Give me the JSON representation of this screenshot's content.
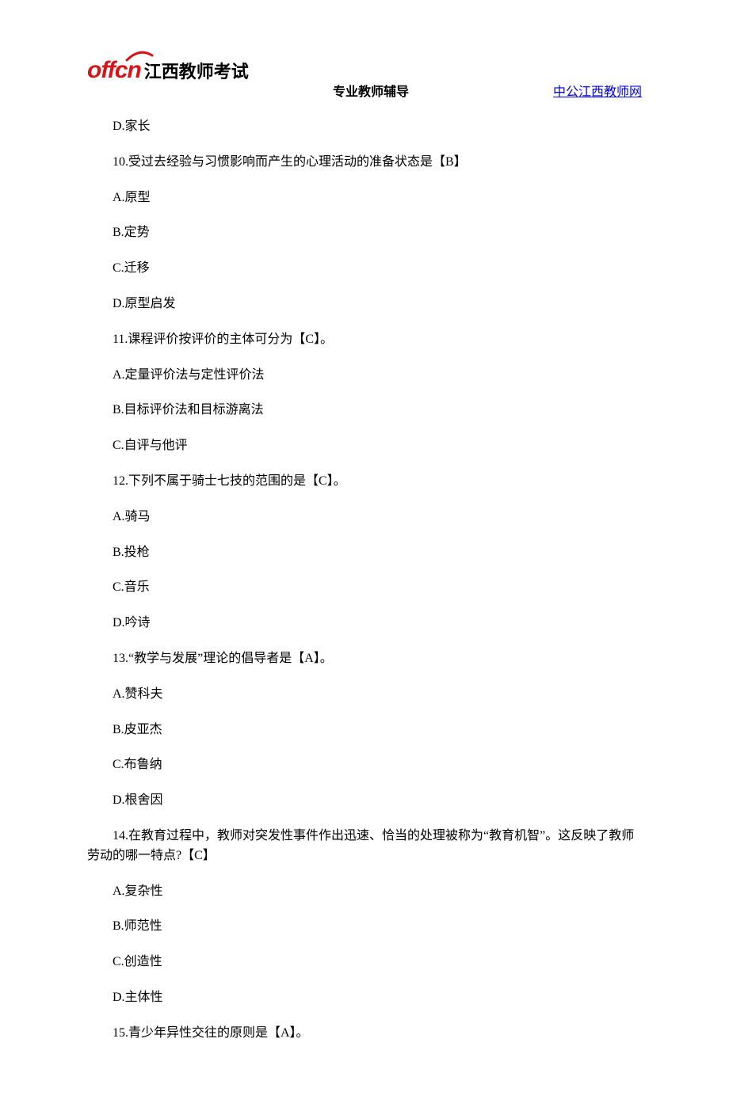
{
  "header": {
    "logo_off": "off",
    "logo_cn": "cn",
    "logo_text": "江西教师考试",
    "center": "专业教师辅导",
    "right": "中公江西教师网"
  },
  "lines": [
    "D.家长",
    "10.受过去经验与习惯影响而产生的心理活动的准备状态是【B】",
    "A.原型",
    "B.定势",
    "C.迁移",
    "D.原型启发",
    "11.课程评价按评价的主体可分为【C】。",
    "A.定量评价法与定性评价法",
    "B.目标评价法和目标游离法",
    "C.自评与他评",
    "12.下列不属于骑士七技的范围的是【C】。",
    "A.骑马",
    "B.投枪",
    "C.音乐",
    "D.吟诗",
    "13.“教学与发展”理论的倡导者是【A】。",
    "A.赞科夫",
    "B.皮亚杰",
    "C.布鲁纳",
    "D.根舍因",
    "14.在教育过程中，教师对突发性事件作出迅速、恰当的处理被称为“教育机智”。这反映了教师劳动的哪一特点?【C】",
    "A.复杂性",
    "B.师范性",
    "C.创造性",
    "D.主体性",
    "15.青少年异性交往的原则是【A】。"
  ],
  "multiline_indices": [
    20
  ]
}
